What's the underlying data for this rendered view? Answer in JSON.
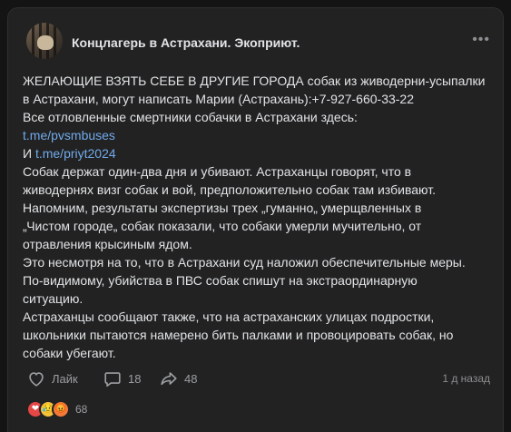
{
  "post": {
    "author": "Концлагерь в Астрахани. Экоприют.",
    "more_icon": "more-dots-icon",
    "lines": [
      {
        "text": "ЖЕЛАЮЩИЕ ВЗЯТЬ СЕБЕ В ДРУГИЕ ГОРОДА собак из живодерни-усыпалки"
      },
      {
        "text": "в Астрахани, могут написать Марии (Астрахань):+7-927-660-33-22"
      },
      {
        "text": "Все отловленные смертники собачки в Астрахани здесь:"
      },
      {
        "link": "t.me/pvsmbuses"
      },
      {
        "prefix": "И ",
        "link": "t.me/priyt2024"
      },
      {
        "text": "Собак держат один-два дня и убивают. Астраханцы говорят, что в"
      },
      {
        "text": "живодернях визг собак и вой, предположительно собак там избивают."
      },
      {
        "text": "Напомним, результаты экспертизы трех „гуманно„ умерщвленных в"
      },
      {
        "text": "„Чистом городе„ собак показали, что собаки умерли мучительно, от"
      },
      {
        "text": "отравления крысиным ядом."
      },
      {
        "text": "Это несмотря на то, что в Астрахани суд наложил обеспечительные меры."
      },
      {
        "text": "По-видимому, убийства в ПВС собак спишут на экстраординарную"
      },
      {
        "text": "ситуацию."
      },
      {
        "text": "Астраханцы сообщают также, что на астраханских улицах подростки,"
      },
      {
        "text": "школьники пытаются намерено бить палками и провоцировать собак, но"
      },
      {
        "text": "собаки убегают."
      }
    ],
    "actions": {
      "like": {
        "label": "Лайк",
        "icon": "heart-icon"
      },
      "comments": {
        "count": "18",
        "icon": "comment-icon"
      },
      "shares": {
        "count": "48",
        "icon": "share-icon"
      }
    },
    "date": "1 д назад",
    "reactions": {
      "emojis": [
        "❤",
        "😥",
        "😡"
      ],
      "count": "68"
    },
    "colors": {
      "background": "#141414",
      "card": "#222222",
      "text": "#e1e3e6",
      "link": "#71aaeb",
      "muted": "#9b9ea2"
    }
  }
}
